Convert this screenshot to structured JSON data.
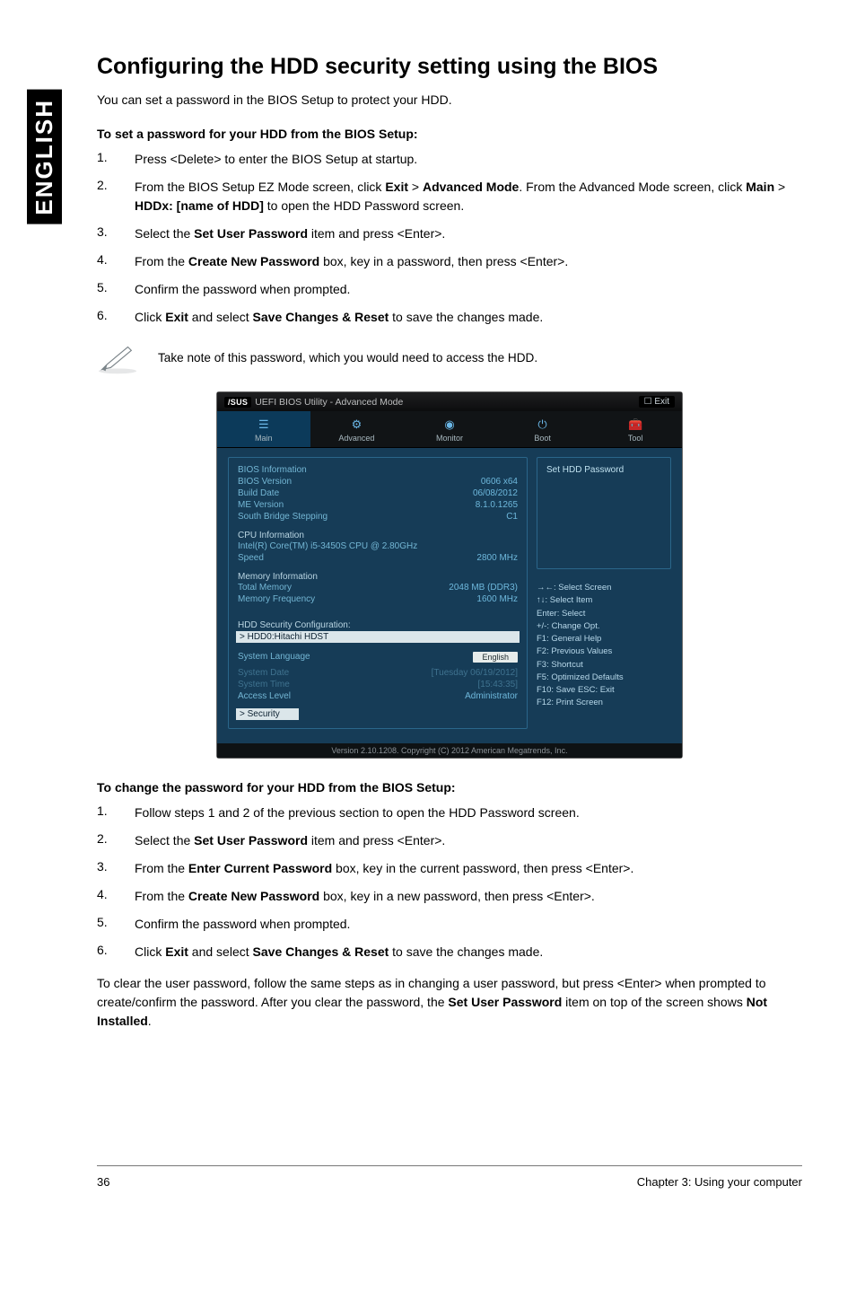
{
  "sidebar": {
    "label": "ENGLISH"
  },
  "heading": "Configuring the HDD security setting using the BIOS",
  "intro": "You can set a password in the BIOS Setup to protect your HDD.",
  "section1_title": "To set a password for your HDD from the BIOS Setup:",
  "steps1": {
    "n1": "1.",
    "t1": "Press <Delete> to enter the BIOS Setup at startup.",
    "n2": "2.",
    "t2_pre": "From the BIOS Setup EZ Mode screen, click ",
    "t2_b1": "Exit",
    "t2_mid1": " > ",
    "t2_b2": "Advanced Mode",
    "t2_mid2": ". From the Advanced Mode screen, click ",
    "t2_b3": "Main",
    "t2_mid3": " > ",
    "t2_b4": "HDDx: [name of HDD]",
    "t2_post": " to open the HDD Password screen.",
    "n3": "3.",
    "t3_pre": "Select the ",
    "t3_b": "Set User Password",
    "t3_post": " item and press <Enter>.",
    "n4": "4.",
    "t4_pre": "From the ",
    "t4_b": "Create New Password",
    "t4_post": " box, key in a password, then press <Enter>.",
    "n5": "5.",
    "t5": "Confirm the password when prompted.",
    "n6": "6.",
    "t6_pre": "Click ",
    "t6_b1": "Exit",
    "t6_mid": " and select ",
    "t6_b2": "Save Changes & Reset",
    "t6_post": " to save the changes made."
  },
  "note": "Take note of this password, which you would need to access the HDD.",
  "bios": {
    "title_brand": "/SUS",
    "title_text": "UEFI BIOS Utility - Advanced Mode",
    "exit": "Exit",
    "tabs": {
      "main": "Main",
      "advanced": "Advanced",
      "monitor": "Monitor",
      "boot": "Boot",
      "tool": "Tool"
    },
    "info": {
      "bios_info_hdr": "BIOS Information",
      "bios_version_l": "BIOS Version",
      "bios_version_v": "0606 x64",
      "build_date_l": "Build Date",
      "build_date_v": "06/08/2012",
      "me_version_l": "ME Version",
      "me_version_v": "8.1.0.1265",
      "sb_step_l": "South Bridge Stepping",
      "sb_step_v": "C1",
      "cpu_info_hdr": "CPU Information",
      "cpu_model": "Intel(R) Core(TM) i5-3450S CPU @ 2.80GHz",
      "speed_l": "Speed",
      "speed_v": "2800 MHz",
      "mem_info_hdr": "Memory Information",
      "total_mem_l": "Total Memory",
      "total_mem_v": "2048 MB (DDR3)",
      "mem_freq_l": "Memory Frequency",
      "mem_freq_v": "1600 MHz",
      "hdd_sec_hdr": "HDD Security Configuration:",
      "hdd_item": "> HDD0:Hitachi HDST",
      "sys_lang_l": "System Language",
      "sys_lang_v": "English",
      "sys_date_l": "System Date",
      "sys_date_v": "[Tuesday 06/19/2012]",
      "sys_time_l": "System Time",
      "sys_time_v": "[15:43:35]",
      "access_l": "Access Level",
      "access_v": "Administrator",
      "security": "> Security"
    },
    "right_title": "Set HDD Password",
    "keys": {
      "k1": "→←: Select Screen",
      "k2": "↑↓: Select Item",
      "k3": "Enter: Select",
      "k4": "+/-: Change Opt.",
      "k5": "F1: General Help",
      "k6": "F2: Previous Values",
      "k7": "F3: Shortcut",
      "k8": "F5: Optimized Defaults",
      "k9": "F10: Save  ESC: Exit",
      "k10": "F12: Print Screen"
    },
    "footer": "Version 2.10.1208. Copyright (C) 2012 American Megatrends, Inc."
  },
  "section2_title": "To change the password for your HDD from the BIOS Setup:",
  "steps2": {
    "n1": "1.",
    "t1": "Follow steps 1 and 2 of the previous section to open the HDD Password screen.",
    "n2": "2.",
    "t2_pre": "Select the ",
    "t2_b": "Set User Password",
    "t2_post": " item and press <Enter>.",
    "n3": "3.",
    "t3_pre": "From the ",
    "t3_b": "Enter Current Password",
    "t3_post": " box, key in the current password, then press <Enter>.",
    "n4": "4.",
    "t4_pre": "From the ",
    "t4_b": "Create New Password",
    "t4_post": " box, key in a new password, then press <Enter>.",
    "n5": "5.",
    "t5": "Confirm the password when prompted.",
    "n6": "6.",
    "t6_pre": "Click ",
    "t6_b1": "Exit",
    "t6_mid": " and select ",
    "t6_b2": "Save Changes & Reset",
    "t6_post": " to save the changes made."
  },
  "final_pre": "To clear the user password, follow the same steps as in changing a user password, but press <Enter> when prompted to create/confirm the password. After you clear the password, the ",
  "final_b1": "Set User Password",
  "final_mid": " item on top of the screen shows ",
  "final_b2": "Not Installed",
  "final_post": ".",
  "footer": {
    "page": "36",
    "chapter": "Chapter 3: Using your computer"
  }
}
